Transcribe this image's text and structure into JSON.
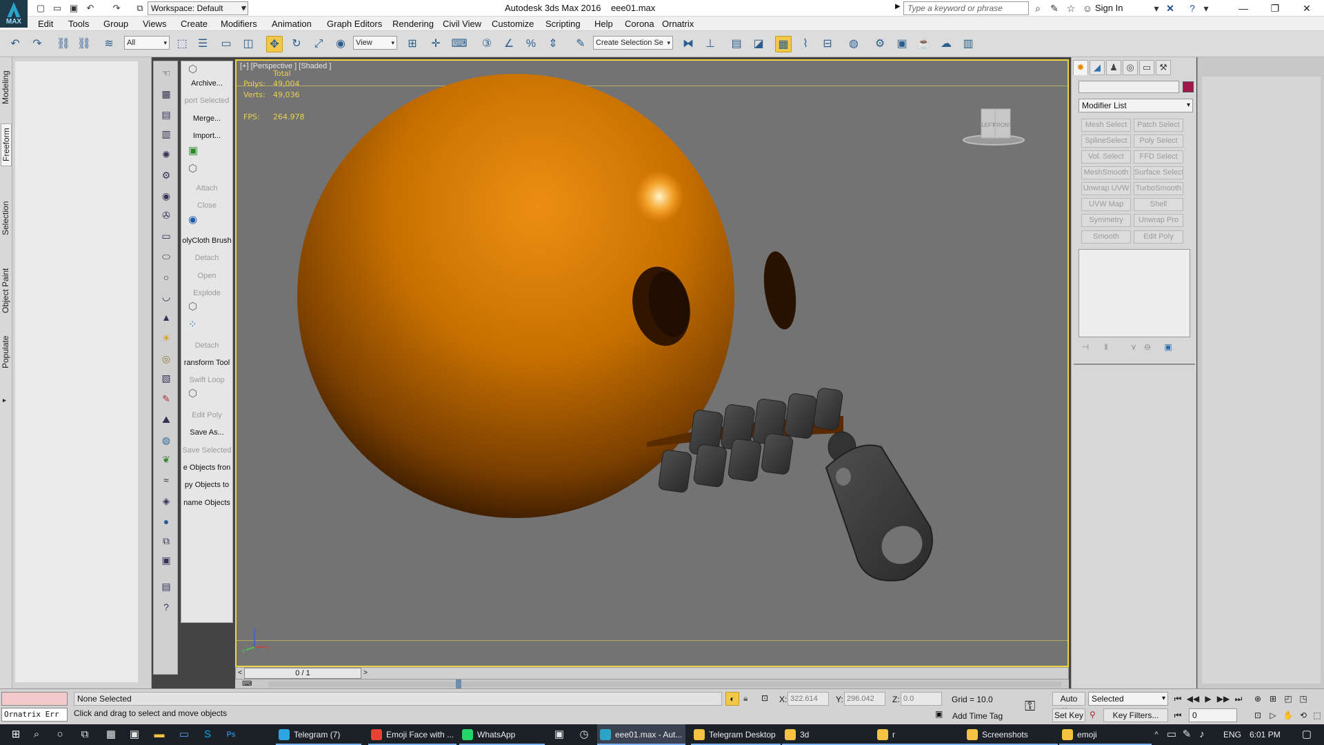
{
  "titlebar": {
    "app_name": "Autodesk 3ds Max 2016",
    "file_name": "eee01.max",
    "logo_text": "MAX",
    "workspace": "Workspace: Default",
    "search_placeholder": "Type a keyword or phrase",
    "sign_in": "Sign In",
    "window_buttons": [
      "minimize",
      "restore",
      "close"
    ]
  },
  "menu": [
    "Edit",
    "Tools",
    "Group",
    "Views",
    "Create",
    "Modifiers",
    "Animation",
    "Graph Editors",
    "Rendering",
    "Civil View",
    "Customize",
    "Scripting",
    "Help",
    "Corona",
    "Ornatrix"
  ],
  "toolbar": {
    "selection_filter": "All",
    "ref_coord": "View",
    "named_selection": "Create Selection Se"
  },
  "ribbon_tabs": [
    "Modeling",
    "Freeform",
    "Selection",
    "Object Paint",
    "Populate"
  ],
  "command_column": {
    "archive": "Archive...",
    "export_selected": "port Selected",
    "merge": "Merge...",
    "import": "Import...",
    "attach": "Attach",
    "close": "Close",
    "polycloth": "olyCloth Brush",
    "detach": "Detach",
    "open": "Open",
    "explode": "Explode",
    "detach2": "Detach",
    "transform_tool": "ransform Tool",
    "swift_loop": "Swift Loop",
    "edit_poly": "Edit Poly",
    "save_as": "Save As...",
    "save_selected": "Save Selected",
    "objects_from": "e Objects fron",
    "copy_objects_to": "py Objects to",
    "rename_objects": "name Objects"
  },
  "viewport": {
    "label": "[+] [Perspective ] [Shaded ]",
    "stats": {
      "total_label": "Total",
      "polys_label": "Polys:",
      "polys_value": "49,004",
      "verts_label": "Verts:",
      "verts_value": "49,036",
      "fps_label": "FPS:",
      "fps_value": "264.978"
    },
    "viewcube": {
      "left": "LEFT",
      "front": "FRONT"
    },
    "colors": {
      "emoji": "#c97200",
      "zipper": "#3d3d3d",
      "background": "#737373",
      "border": "#f3d340"
    }
  },
  "timeline": {
    "frame": "0 / 1"
  },
  "command_panel": {
    "modifier_list": "Modifier List",
    "object_color": "#a1174a",
    "modifier_buttons": [
      [
        "Mesh Select",
        "Patch Select"
      ],
      [
        "SplineSelect",
        "Poly Select"
      ],
      [
        "Vol. Select",
        "FFD Select"
      ],
      [
        "MeshSmooth",
        "Surface Select"
      ],
      [
        "Unwrap UVW",
        "TurboSmooth"
      ],
      [
        "UVW Map",
        "Shell"
      ],
      [
        "Symmetry",
        "Unwrap Pro"
      ],
      [
        "Smooth",
        "Edit Poly"
      ]
    ]
  },
  "status": {
    "maxscript": "Ornatrix Err",
    "selection": "None Selected",
    "prompt": "Click and drag to select and move objects",
    "x_label": "X:",
    "x_value": "322.614",
    "y_label": "Y:",
    "y_value": "296.042",
    "z_label": "Z:",
    "z_value": "0.0",
    "grid": "Grid = 10.0",
    "add_time_tag": "Add Time Tag",
    "auto_key": "Auto Key",
    "set_key": "Set Key",
    "key_mode": "Selected",
    "key_filters": "Key Filters...",
    "current_frame": "0"
  },
  "taskbar": {
    "items": [
      {
        "label": "Telegram (7)",
        "color": "#2ca5e0"
      },
      {
        "label": "Emoji Face with ...",
        "color": "#e94235"
      },
      {
        "label": "WhatsApp",
        "color": "#25d366"
      },
      {
        "label": "eee01.max - Aut...",
        "color": "#2ba4c7"
      },
      {
        "label": "Telegram Desktop",
        "color": "#f5c242"
      },
      {
        "label": "3d",
        "color": "#f5c242"
      },
      {
        "label": "r",
        "color": "#f5c242"
      },
      {
        "label": "Screenshots",
        "color": "#f5c242"
      },
      {
        "label": "emoji",
        "color": "#f5c242"
      }
    ],
    "language": "ENG",
    "time": "6:01 PM"
  }
}
